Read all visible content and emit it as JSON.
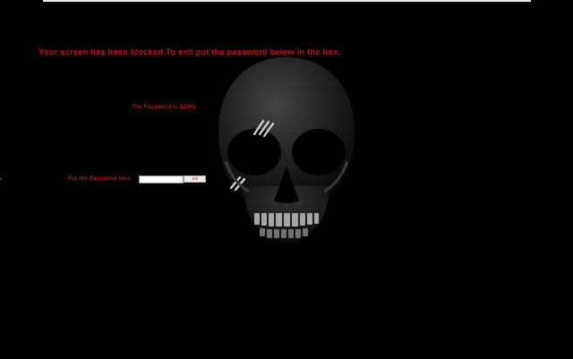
{
  "colors": {
    "background": "#000000",
    "text_red": "#b3151b",
    "bar": "#e9e9e9"
  },
  "lock_screen": {
    "headline": "Your screen has been blocked.To exit put the password below in the box.",
    "password_hint": "The Password is:12345",
    "password_field_label": "Put the Password here",
    "password_input_value": "",
    "unlock_button_label": "Jeb",
    "background_image": "skull"
  }
}
